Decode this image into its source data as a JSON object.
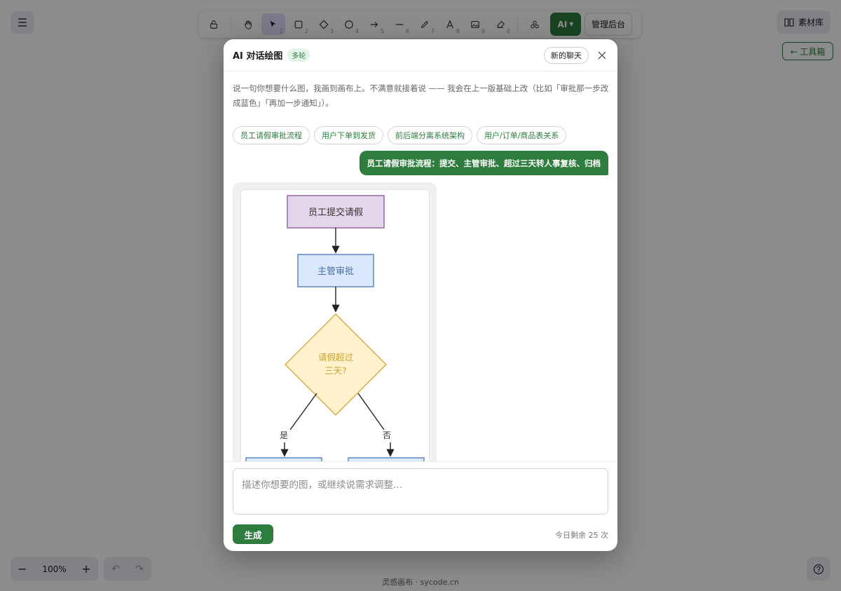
{
  "toolbar": {
    "tools": [
      {
        "name": "lock",
        "key": ""
      },
      {
        "name": "hand",
        "key": ""
      },
      {
        "name": "select",
        "key": "1"
      },
      {
        "name": "rectangle",
        "key": "2"
      },
      {
        "name": "diamond",
        "key": "3"
      },
      {
        "name": "ellipse",
        "key": "4"
      },
      {
        "name": "arrow",
        "key": "5"
      },
      {
        "name": "line",
        "key": "6"
      },
      {
        "name": "pencil",
        "key": "7"
      },
      {
        "name": "text",
        "key": "8"
      },
      {
        "name": "image",
        "key": "9"
      },
      {
        "name": "eraser",
        "key": "0"
      }
    ],
    "ai_label": "AI",
    "admin_label": "管理后台"
  },
  "topright": {
    "library_label": "素材库",
    "toolbox_label": "← 工具箱"
  },
  "bottom": {
    "zoom_out": "−",
    "zoom_level": "100%",
    "zoom_in": "+",
    "footer": "灵感画布 · sycode.cn"
  },
  "modal": {
    "title": "AI 对话绘图",
    "badge": "多轮",
    "new_chat": "新的聊天",
    "intro": "说一句你想要什么图，我画到画布上。不满意就接着说 —— 我会在上一版基础上改（比如「审批那一步改成蓝色」「再加一步通知」）。",
    "chips": [
      "员工请假审批流程",
      "用户下单到发货",
      "前后端分离系统架构",
      "用户/订单/商品表关系"
    ],
    "user_message": "员工请假审批流程：提交、主管审批、超过三天转人事复核、归档",
    "diagram": {
      "node_submit": "员工提交请假",
      "node_manager": "主管审批",
      "decision_line1": "请假超过",
      "decision_line2": "三天?",
      "branch_yes": "是",
      "branch_no": "否"
    },
    "input_placeholder": "描述你想要的图，或继续说需求调整...",
    "generate_label": "生成",
    "quota": "今日剩余 25 次"
  },
  "colors": {
    "accent": "#2e7d3e",
    "purple_fill": "#e5d5ea",
    "purple_stroke": "#9c6fa8",
    "blue_fill": "#dae8fc",
    "blue_stroke": "#6c8ebf",
    "yellow_fill": "#fff2cc",
    "yellow_stroke": "#d6b656"
  }
}
